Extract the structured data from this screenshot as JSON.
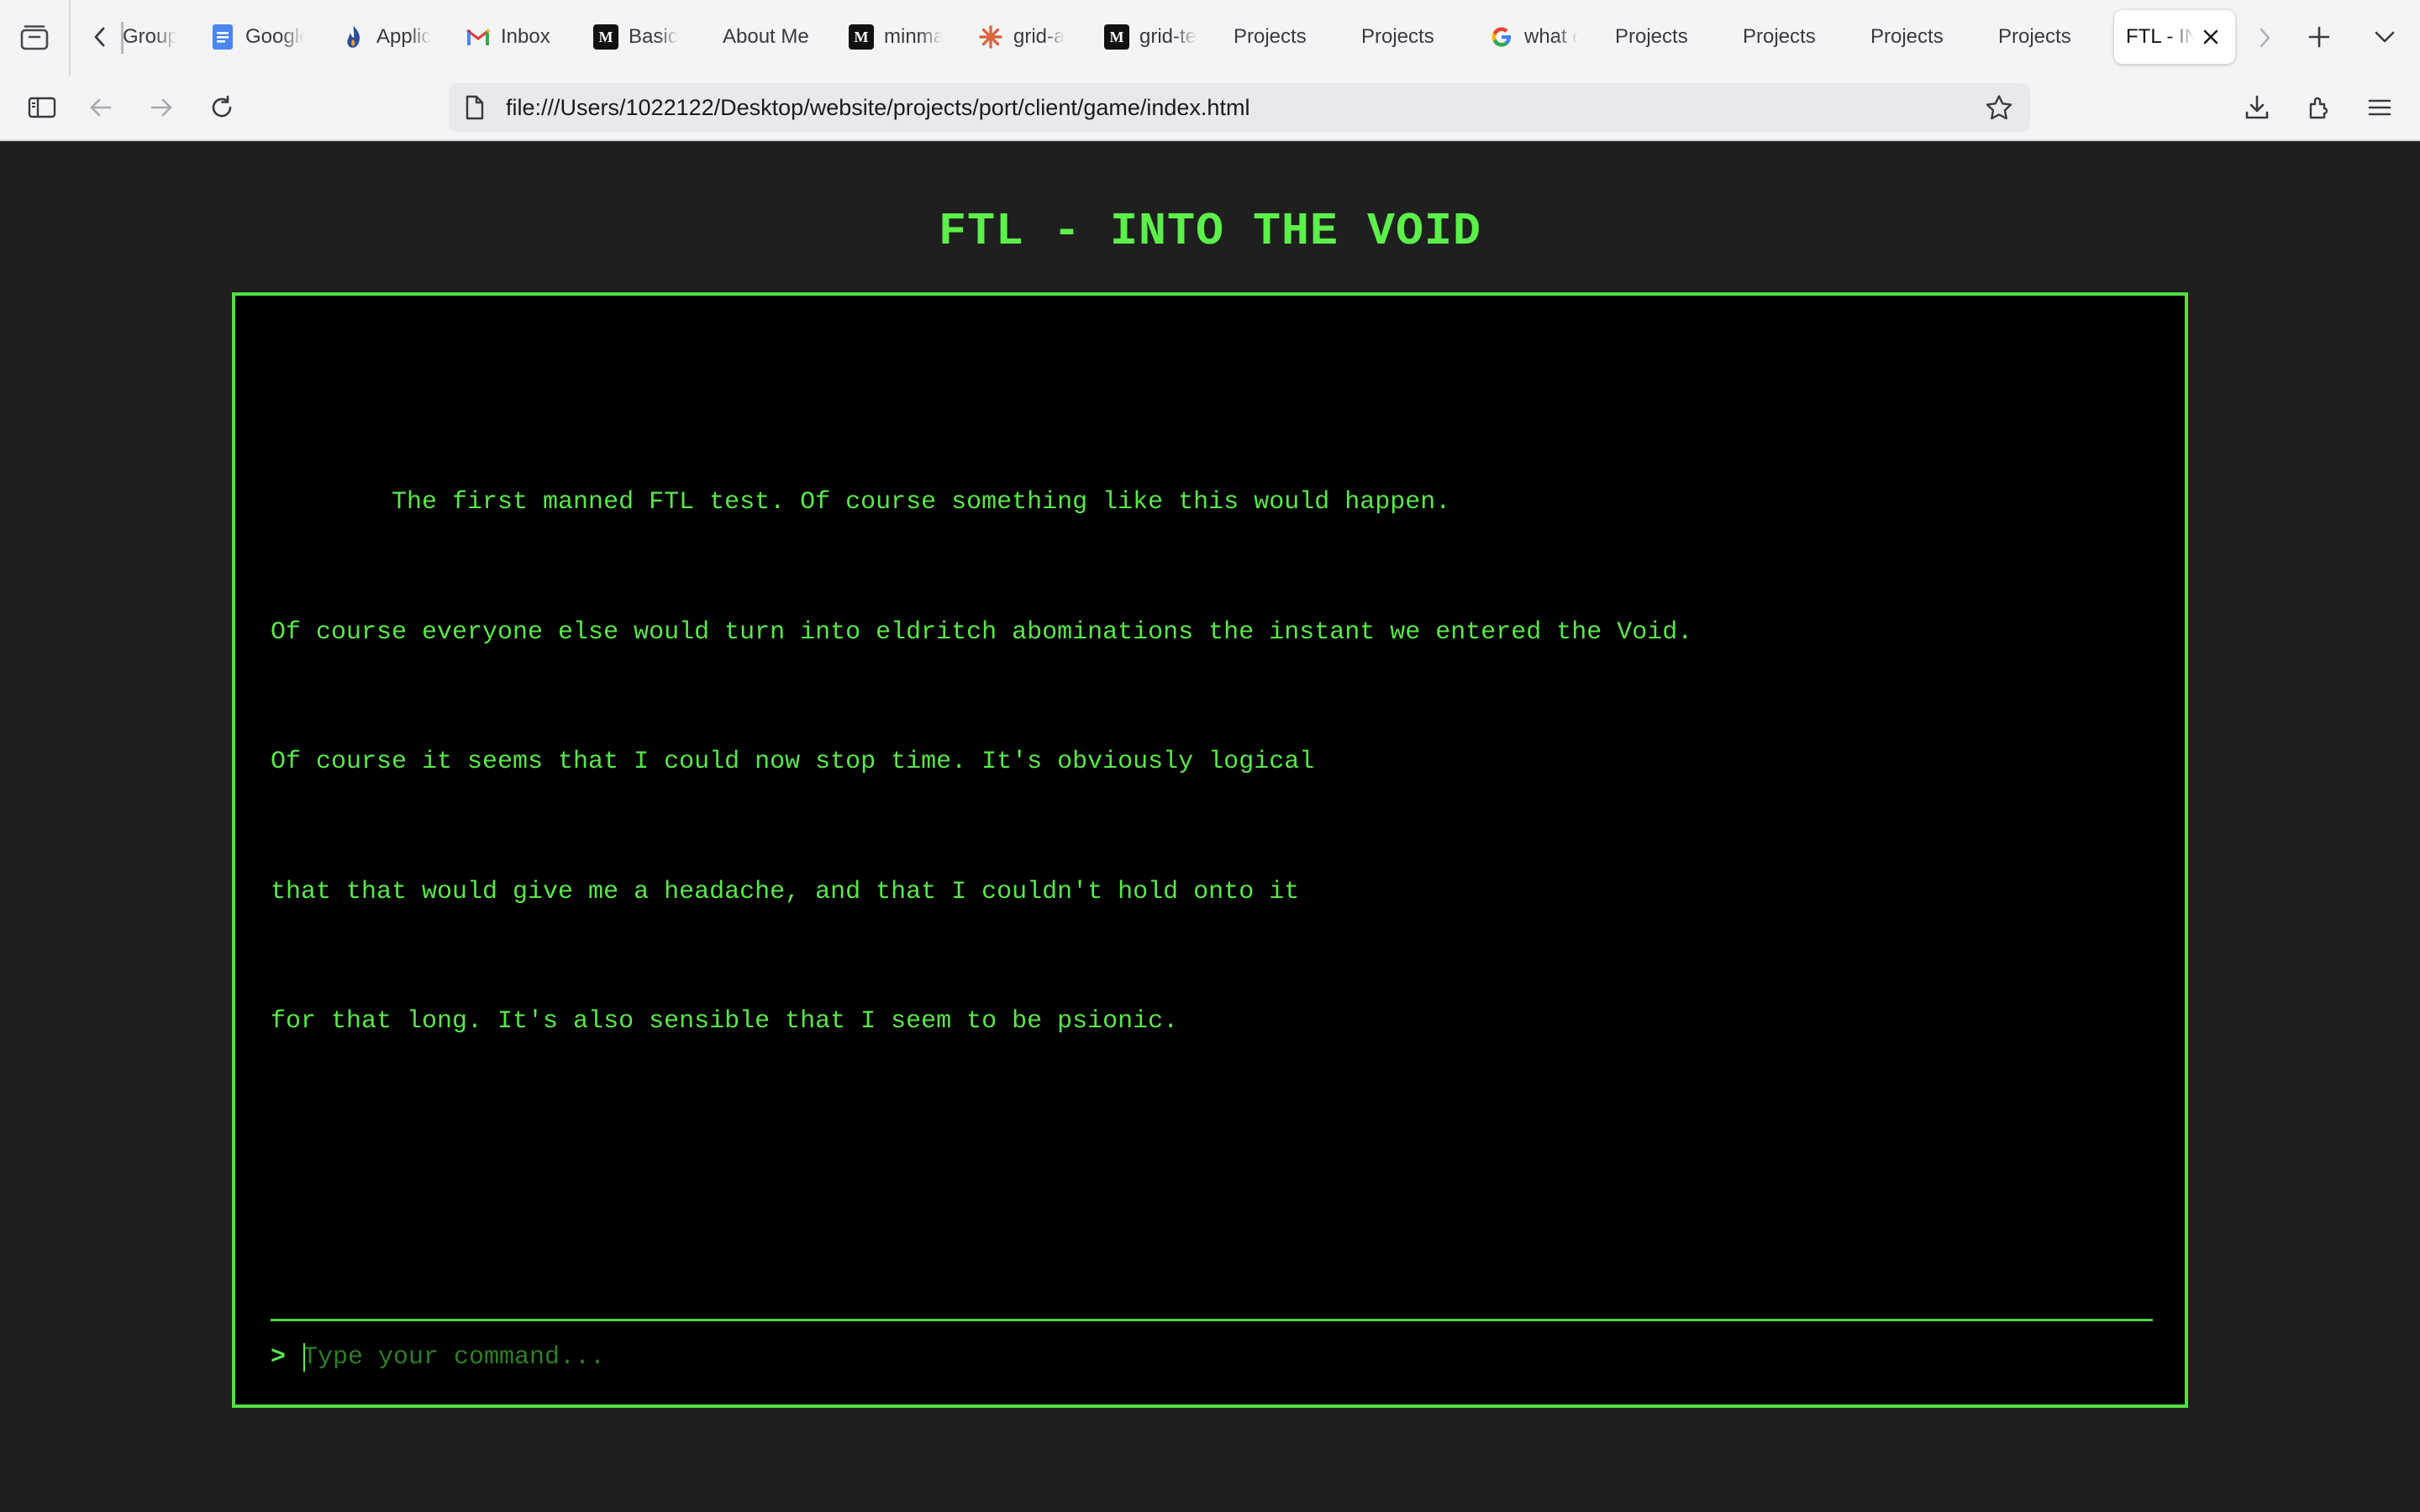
{
  "browser": {
    "tabs": [
      {
        "label": "Group",
        "icon": "chevron-left-icon"
      },
      {
        "label": "Google Docs",
        "icon": "google-docs-icon"
      },
      {
        "label": "Applic",
        "icon": "flame-icon"
      },
      {
        "label": "Inbox",
        "icon": "gmail-icon"
      },
      {
        "label": "Basic",
        "icon": "notion-icon"
      },
      {
        "label": "About Me",
        "icon": ""
      },
      {
        "label": "minma",
        "icon": "notion-icon"
      },
      {
        "label": "grid-a",
        "icon": "claude-icon"
      },
      {
        "label": "grid-te",
        "icon": "notion-icon"
      },
      {
        "label": "Projects",
        "icon": ""
      },
      {
        "label": "Projects",
        "icon": ""
      },
      {
        "label": "what c",
        "icon": "google-icon"
      },
      {
        "label": "Projects",
        "icon": ""
      },
      {
        "label": "Projects",
        "icon": ""
      },
      {
        "label": "Projects",
        "icon": ""
      },
      {
        "label": "Projects",
        "icon": ""
      },
      {
        "label": "FTL - INTO THE VOID",
        "icon": "",
        "active": true
      }
    ],
    "url": "file:///Users/1022122/Desktop/website/projects/port/client/game/index.html"
  },
  "game": {
    "title": "FTL - INTO THE VOID",
    "story_lines": [
      "        The first manned FTL test. Of course something like this would happen.",
      "Of course everyone else would turn into eldritch abominations the instant we entered the Void.",
      "Of course it seems that I could now stop time. It's obviously logical",
      "that that would give me a headache, and that I couldn't hold onto it",
      "for that long. It's also sensible that I seem to be psionic."
    ],
    "prompt_symbol": ">",
    "input_placeholder": "Type your command...",
    "input_value": ""
  },
  "colors": {
    "terminal_green": "#59e74a",
    "page_background": "#1f1f1f",
    "terminal_background": "#000000"
  }
}
